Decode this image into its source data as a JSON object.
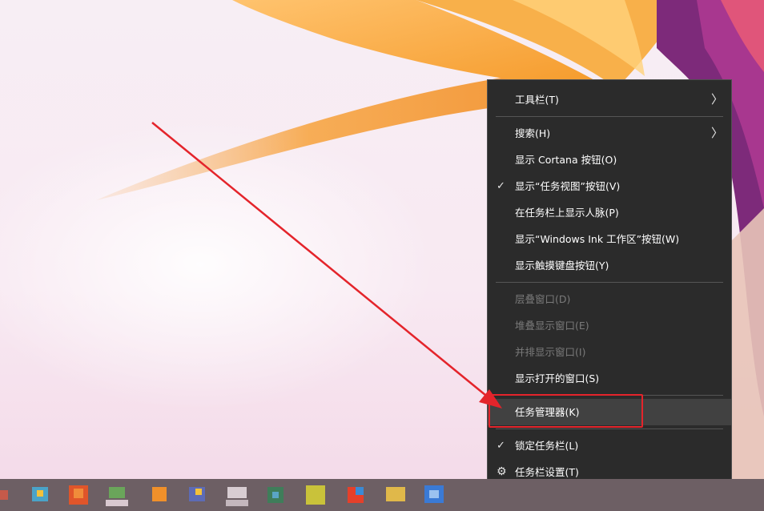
{
  "context_menu": {
    "items": [
      {
        "label": "工具栏(T)",
        "checked": false,
        "has_submenu": true,
        "disabled": false
      },
      {
        "label": "搜索(H)",
        "checked": false,
        "has_submenu": true,
        "disabled": false
      },
      {
        "label": "显示 Cortana 按钮(O)",
        "checked": false,
        "has_submenu": false,
        "disabled": false
      },
      {
        "label": "显示“任务视图”按钮(V)",
        "checked": true,
        "has_submenu": false,
        "disabled": false
      },
      {
        "label": "在任务栏上显示人脉(P)",
        "checked": false,
        "has_submenu": false,
        "disabled": false
      },
      {
        "label": "显示“Windows Ink 工作区”按钮(W)",
        "checked": false,
        "has_submenu": false,
        "disabled": false
      },
      {
        "label": "显示触摸键盘按钮(Y)",
        "checked": false,
        "has_submenu": false,
        "disabled": false
      },
      {
        "label": "层叠窗口(D)",
        "checked": false,
        "has_submenu": false,
        "disabled": true
      },
      {
        "label": "堆叠显示窗口(E)",
        "checked": false,
        "has_submenu": false,
        "disabled": true
      },
      {
        "label": "并排显示窗口(I)",
        "checked": false,
        "has_submenu": false,
        "disabled": true
      },
      {
        "label": "显示打开的窗口(S)",
        "checked": false,
        "has_submenu": false,
        "disabled": false
      },
      {
        "label": "任务管理器(K)",
        "checked": false,
        "has_submenu": false,
        "disabled": false,
        "highlighted": true
      },
      {
        "label": "锁定任务栏(L)",
        "checked": true,
        "has_submenu": false,
        "disabled": false
      },
      {
        "label": "任务栏设置(T)",
        "checked": false,
        "has_submenu": false,
        "disabled": false,
        "icon": "gear-icon"
      }
    ]
  },
  "icons": {
    "check": "✓",
    "chevron": "〉",
    "gear": "⚙"
  },
  "colors": {
    "menu_bg": "#2b2b2b",
    "highlight_box": "#e4242b",
    "arrow": "#e4242b",
    "taskbar": "#6d5f64"
  }
}
